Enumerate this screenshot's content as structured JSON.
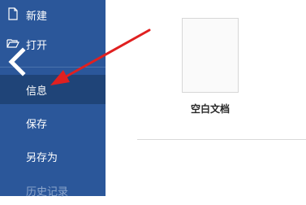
{
  "sidebar": {
    "background": "#2b579a",
    "items": [
      {
        "label": "新建",
        "icon": "new-document-icon"
      },
      {
        "label": "打开",
        "icon": "folder-open-icon"
      },
      {
        "label": "信息",
        "active": true
      },
      {
        "label": "保存"
      },
      {
        "label": "另存为"
      },
      {
        "label": "历史记录",
        "dimmed": true
      }
    ],
    "back_icon": "back-arrow-icon"
  },
  "main": {
    "template": {
      "label": "空白文档"
    }
  },
  "annotation": {
    "color": "#e02020",
    "icon": "red-arrow-annotation"
  }
}
